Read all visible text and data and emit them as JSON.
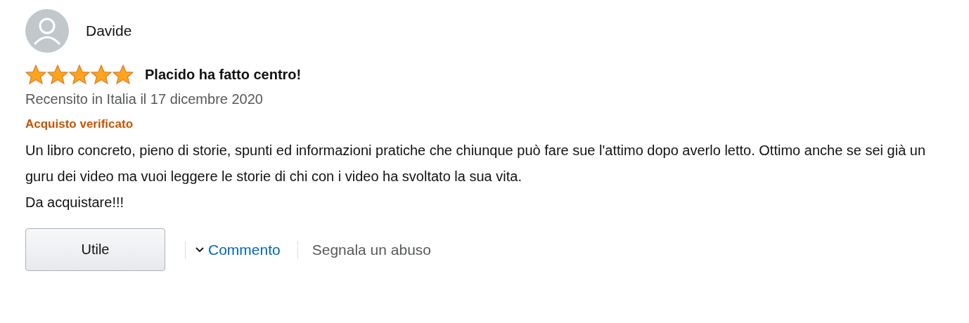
{
  "reviewer": {
    "name": "Davide"
  },
  "review": {
    "stars": 5,
    "title": "Placido ha fatto centro!",
    "date": "Recensito in Italia il 17 dicembre 2020",
    "badge": "Acquisto verificato",
    "body": "Un libro concreto, pieno di storie, spunti ed informazioni pratiche che chiunque può fare sue l'attimo dopo averlo letto. Ottimo anche se sei già un guru dei video ma vuoi leggere le storie di chi con i video ha svoltato la sua vita.\nDa acquistare!!!"
  },
  "actions": {
    "helpful": "Utile",
    "comment": "Commento",
    "report": "Segnala un abuso"
  }
}
